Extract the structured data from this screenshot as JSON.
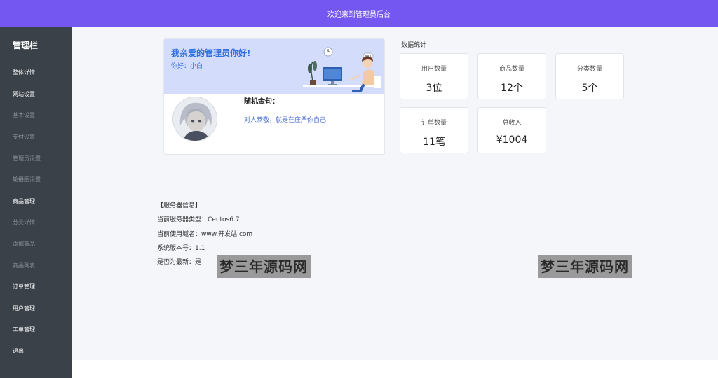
{
  "topbar": {
    "title": "欢迎来到管理员后台"
  },
  "sidebar": {
    "title": "管理栏",
    "items": [
      {
        "label": "整体详情",
        "style": "bright"
      },
      {
        "label": "网站设置",
        "style": "bright"
      },
      {
        "label": "基本设置",
        "style": "dim"
      },
      {
        "label": "支付设置",
        "style": "dim"
      },
      {
        "label": "管理员设置",
        "style": "dim"
      },
      {
        "label": "轮播图设置",
        "style": "dim"
      },
      {
        "label": "商品管理",
        "style": "bright"
      },
      {
        "label": "分类详情",
        "style": "dim"
      },
      {
        "label": "添加商品",
        "style": "dim"
      },
      {
        "label": "商品列表",
        "style": "dim"
      },
      {
        "label": "订单管理",
        "style": "bright"
      },
      {
        "label": "用户管理",
        "style": "bright"
      },
      {
        "label": "工单管理",
        "style": "bright"
      },
      {
        "label": "退出",
        "style": "bright"
      }
    ]
  },
  "welcome": {
    "heading": "我亲爱的管理员你好!",
    "greeting": "你好：小白",
    "quote_title": "随机金句：",
    "quote_text": "对人恭敬，就是在庄严你自己"
  },
  "stats": {
    "title": "数据统计",
    "cards": [
      {
        "label": "用户数量",
        "value": "3位"
      },
      {
        "label": "商品数量",
        "value": "12个"
      },
      {
        "label": "分类数量",
        "value": "5个"
      },
      {
        "label": "订单数量",
        "value": "11笔"
      },
      {
        "label": "总收入",
        "value": "¥1004"
      }
    ]
  },
  "server": {
    "header": "【服务器信息】",
    "type": "当前服务器类型：Centos6.7",
    "domain": "当前使用域名：www.开发站.com",
    "version": "系统版本号：1.1",
    "latest": "是否为最新：是"
  },
  "watermarks": [
    "梦三年源码网",
    "梦三年源码网"
  ],
  "colors": {
    "topbar": "#7457f0",
    "sidebar": "#3a4148",
    "banner": "#d4dcfb",
    "accent_text": "#2f6fe0"
  }
}
